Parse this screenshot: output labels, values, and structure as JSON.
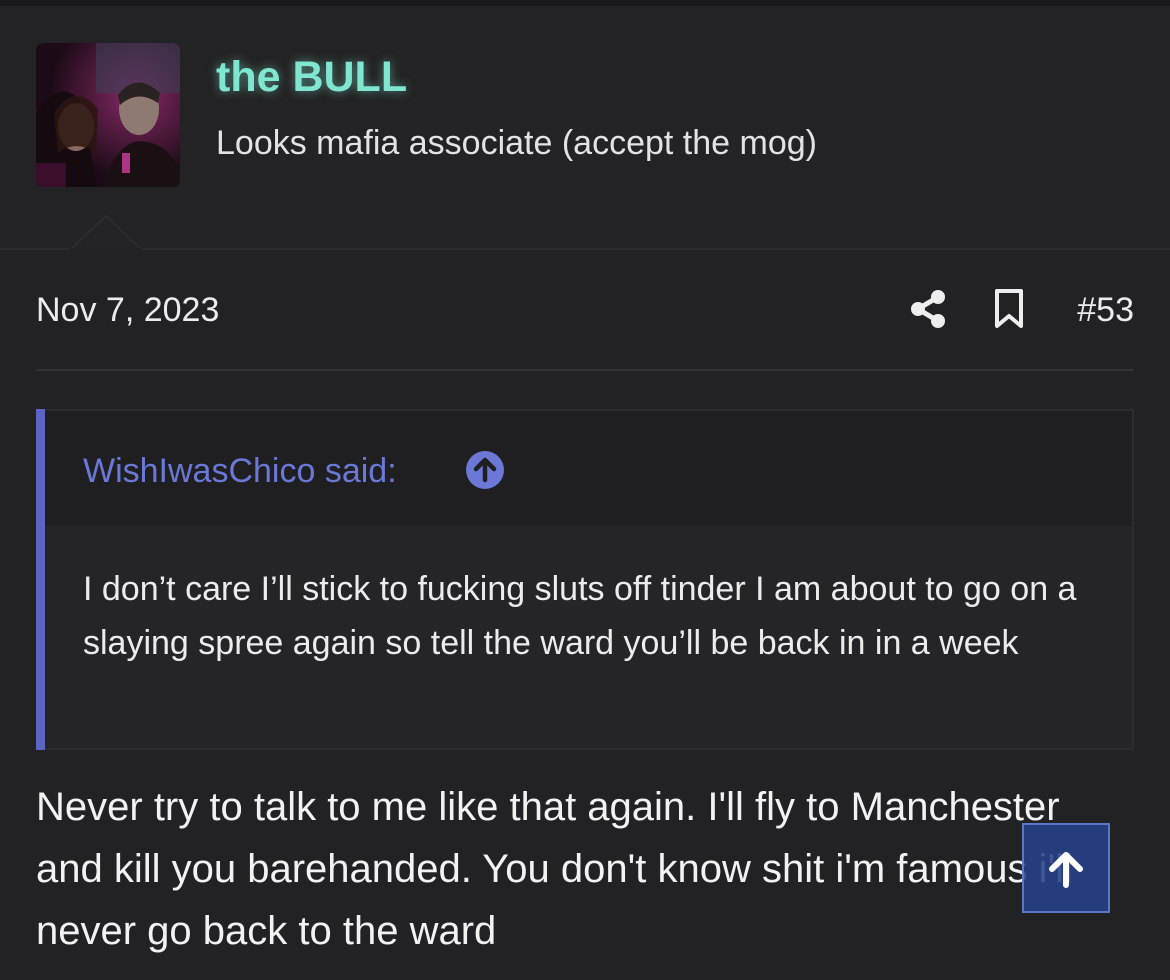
{
  "user": {
    "username": "the BULL",
    "title": "Looks mafia associate (accept the mog)",
    "avatar_icon": "avatar-photo"
  },
  "post": {
    "date": "Nov 7, 2023",
    "number": "#53",
    "share_icon": "share-icon",
    "bookmark_icon": "bookmark-icon",
    "body": "Never try to talk to me like that again. I'll fly to Manchester and kill you barehanded. You don't know shit i'm famous i'll never go back to the ward"
  },
  "quote": {
    "author_label": "WishIwasChico said:",
    "jump_icon": "arrow-up-circle-icon",
    "text": "I don’t care I’ll stick to fucking sluts off tinder I am about to go on a slaying spree again so tell the ward you’ll be back in in a week"
  },
  "scroll_top": {
    "icon": "arrow-up-icon"
  },
  "colors": {
    "background": "#222224",
    "username": "#7fe6cf",
    "quote_accent": "#5c66c2",
    "quote_author": "#6b78d6",
    "scroll_button": "#26418a"
  }
}
